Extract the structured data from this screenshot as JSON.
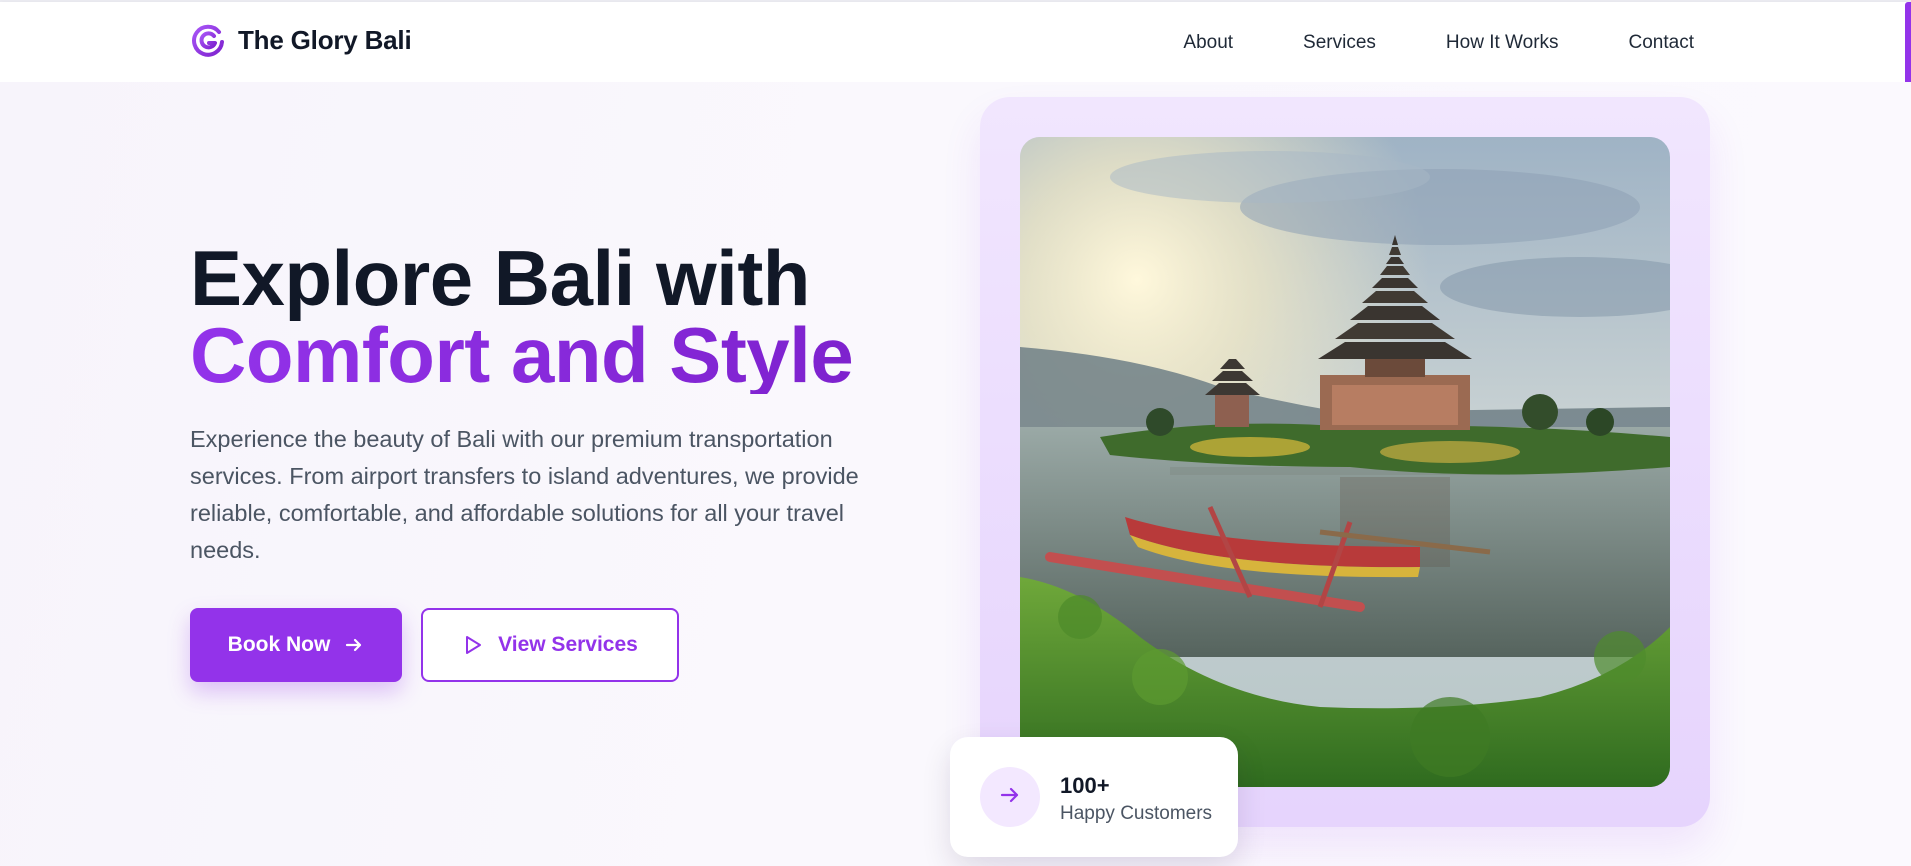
{
  "brand": {
    "name": "The Glory Bali",
    "logo_icon": "glory-g-logo-icon",
    "accent_color": "#9333ea",
    "accent_light": "#f3e8ff"
  },
  "nav": {
    "items": [
      {
        "label": "About"
      },
      {
        "label": "Services"
      },
      {
        "label": "How It Works"
      },
      {
        "label": "Contact"
      }
    ]
  },
  "hero": {
    "headline_line1": "Explore Bali with",
    "headline_line2": "Comfort and Style",
    "description": "Experience the beauty of Bali with our premium transportation services. From airport transfers to island adventures, we provide reliable, comfortable, and affordable solutions for all your travel needs.",
    "primary_button": {
      "label": "Book Now",
      "icon": "arrow-right-icon"
    },
    "secondary_button": {
      "label": "View Services",
      "icon": "play-icon"
    }
  },
  "image": {
    "subject": "bali-temple-on-lake-photo"
  },
  "stats": {
    "value": "100+",
    "label": "Happy Customers",
    "icon": "arrow-right-icon"
  }
}
